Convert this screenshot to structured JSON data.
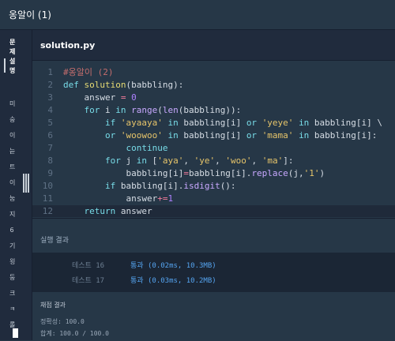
{
  "header": {
    "title": "옹알이 (1)"
  },
  "sidebar": {
    "tab_label": "문제 설명",
    "vertical_text": "미 숭 이 늗 트 이 눔 지 6 기 욍 둥 크 ㅋ 롤"
  },
  "editor": {
    "filename": "solution.py",
    "lines": [
      {
        "n": "1",
        "t": "#옹알이 (2)"
      },
      {
        "n": "2",
        "t": "def solution(babbling):"
      },
      {
        "n": "3",
        "t": "    answer = 0"
      },
      {
        "n": "4",
        "t": "    for i in range(len(babbling)):"
      },
      {
        "n": "5",
        "t": "        if 'ayaaya' in babbling[i] or 'yeye' in babbling[i] \\"
      },
      {
        "n": "6",
        "t": "        or 'woowoo' in babbling[i] or 'mama' in babbling[i]:"
      },
      {
        "n": "7",
        "t": "            continue"
      },
      {
        "n": "8",
        "t": "        for j in ['aya', 'ye', 'woo', 'ma']:"
      },
      {
        "n": "9",
        "t": "            babbling[i]=babbling[i].replace(j,'1')"
      },
      {
        "n": "10",
        "t": "        if babbling[i].isdigit():"
      },
      {
        "n": "11",
        "t": "            answer+=1"
      },
      {
        "n": "12",
        "t": "    return answer"
      }
    ]
  },
  "results": {
    "heading": "실행 결과",
    "rows": [
      {
        "name": "테스트 16",
        "value": "통과 (0.02ms, 10.3MB)"
      },
      {
        "name": "테스트 17",
        "value": "통과 (0.03ms, 10.2MB)"
      }
    ],
    "grade": {
      "heading": "채점 결과",
      "accuracy": "정확성: 100.0",
      "total": "합계: 100.0 / 100.0"
    }
  }
}
